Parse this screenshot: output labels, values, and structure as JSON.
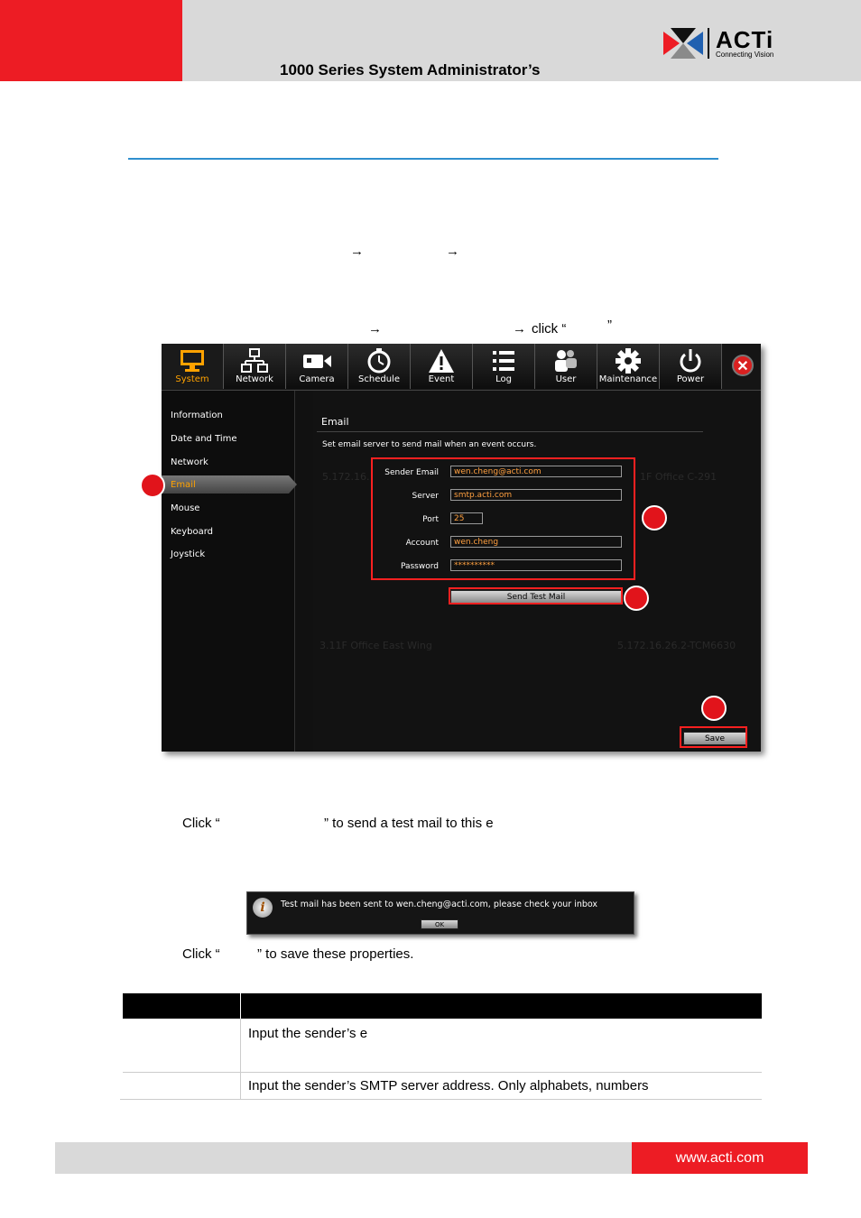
{
  "header": {
    "doc_title": "1000 Series System Administrator’s",
    "logo_text": "ACTi",
    "logo_tagline": "Connecting Vision",
    "brand_red": "#ed1c24"
  },
  "body_text": {
    "arrow_line_1": "",
    "arrow_line_2": "click “",
    "arrow_line_2_close": "”",
    "step2_prefix": "Click “",
    "step2_suffix": "” to send a test mail to this e",
    "step3_prefix": "Click “",
    "step3_suffix": "” to save these properties.",
    "arrow_glyph": "→"
  },
  "app": {
    "toolbar": [
      {
        "label": "System",
        "icon": "monitor-icon",
        "active": true
      },
      {
        "label": "Network",
        "icon": "network-icon"
      },
      {
        "label": "Camera",
        "icon": "camera-icon"
      },
      {
        "label": "Schedule",
        "icon": "clock-icon"
      },
      {
        "label": "Event",
        "icon": "warning-icon"
      },
      {
        "label": "Log",
        "icon": "list-icon"
      },
      {
        "label": "User",
        "icon": "users-icon"
      },
      {
        "label": "Maintenance",
        "icon": "gear-icon"
      },
      {
        "label": "Power",
        "icon": "power-icon"
      }
    ],
    "close_glyph": "✕",
    "sidebar": [
      "Information",
      "Date and Time",
      "Network",
      "Email",
      "Mouse",
      "Keyboard",
      "Joystick"
    ],
    "section_title": "Email",
    "section_desc": "Set email server to send mail when an event occurs.",
    "fields": {
      "sender_label": "Sender Email",
      "sender_value": "wen.cheng@acti.com",
      "server_label": "Server",
      "server_value": "smtp.acti.com",
      "port_label": "Port",
      "port_value": "25",
      "account_label": "Account",
      "account_value": "wen.cheng",
      "password_label": "Password",
      "password_value": "**********"
    },
    "test_button": "Send Test Mail",
    "save_button": "Save",
    "ghost_row_1": "5.172.16.",
    "ghost_row_1b": "1F Office C-291",
    "ghost_row_2": "3.11F Office East Wing",
    "ghost_row_2b": "5.172.16.26.2-TCM6630"
  },
  "popup": {
    "message": "Test mail has been sent to wen.cheng@acti.com, please check your inbox",
    "ok_button": "OK",
    "info_glyph": "i"
  },
  "table": {
    "row1_desc": "Input the sender’s e",
    "row2_desc": "Input the sender’s SMTP server address. Only alphabets, numbers"
  },
  "footer": {
    "url": "www.acti.com"
  }
}
